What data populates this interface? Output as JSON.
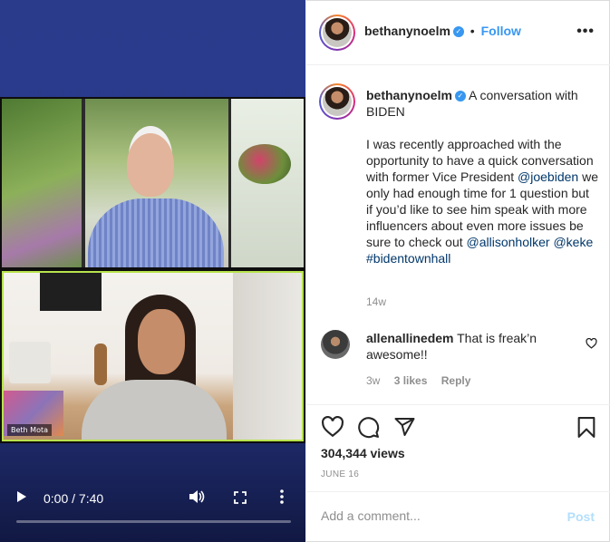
{
  "video": {
    "participant_label": "Beth Mota",
    "current_time": "0:00",
    "duration": "7:40",
    "time_display": "0:00 / 7:40",
    "progress_fraction": 0.0,
    "icons": [
      "play-icon",
      "volume-icon",
      "fullscreen-icon",
      "more-vertical-icon"
    ]
  },
  "header": {
    "username": "bethanynoelm",
    "separator": "•",
    "follow_label": "Follow",
    "more_label": "•••"
  },
  "caption": {
    "username": "bethanynoelm",
    "title_text": "A conversation with BIDEN",
    "body_before_mention": "I was recently approached with the opportunity to have a quick conversation with former Vice President",
    "mention_joe": "@joebiden",
    "body_middle": "we only had enough time for 1 question but if you’d like to see him speak with more influencers about even more issues be sure to check out",
    "mention_allison": "@allisonholker",
    "mention_keke": "@keke",
    "hashtag": "#bidentownhall",
    "age": "14w"
  },
  "comment": {
    "username": "allenallinedem",
    "text": "That is freak’n awesome!!",
    "age": "3w",
    "likes": "3 likes",
    "reply_label": "Reply"
  },
  "actions": {
    "views": "304,344 views",
    "date": "JUNE 16",
    "icons": [
      "heart-icon",
      "comment-icon",
      "share-icon",
      "bookmark-icon"
    ]
  },
  "add_comment": {
    "placeholder": "Add a comment...",
    "post_label": "Post"
  },
  "colors": {
    "accent": "#3897f0",
    "mention": "#00376b",
    "muted": "#8e8e8e",
    "post_disabled": "#b2dffc",
    "video_bg": "#2a3b8c"
  }
}
